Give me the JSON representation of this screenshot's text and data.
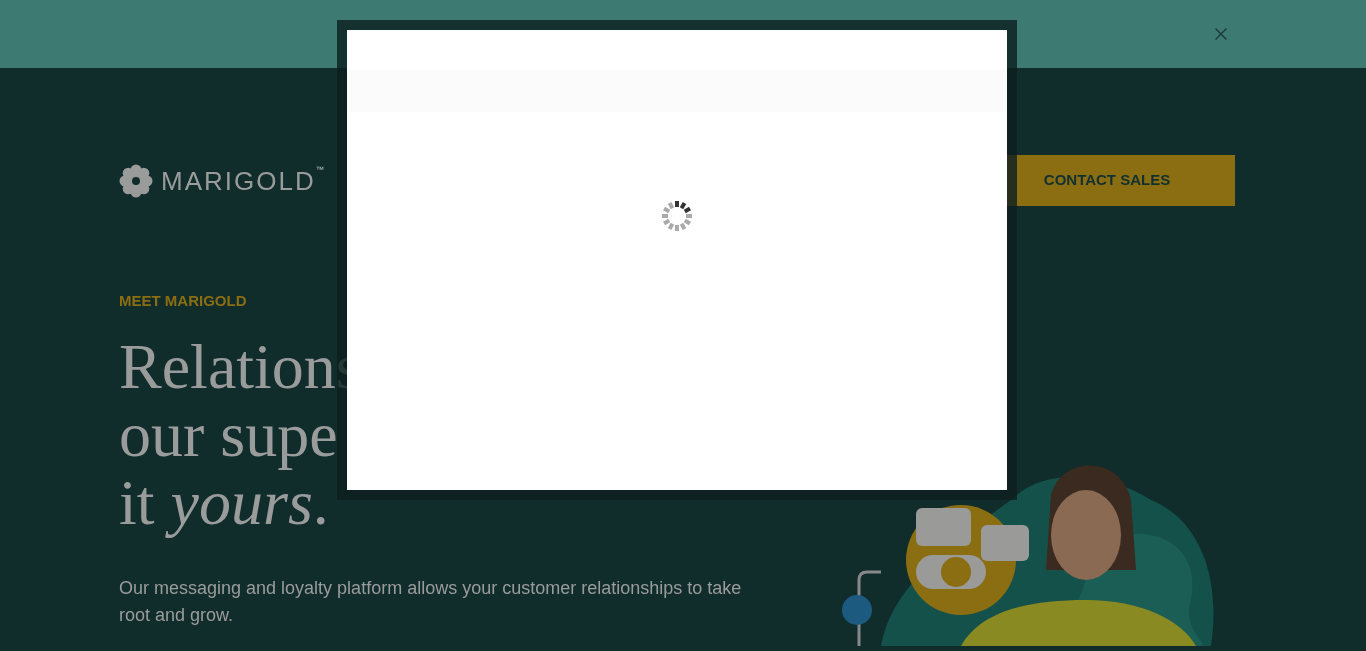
{
  "brand": {
    "name": "MARIGOLD",
    "trademark": "™"
  },
  "header": {
    "cta": "CONTACT SALES"
  },
  "hero": {
    "eyebrow": "MEET MARIGOLD",
    "headline_lines": [
      "Relations",
      "our supe",
      "it *yours*."
    ],
    "body": "Our messaging and loyalty platform allows your customer relationships to take root and grow."
  },
  "modal": {
    "loading": true
  }
}
